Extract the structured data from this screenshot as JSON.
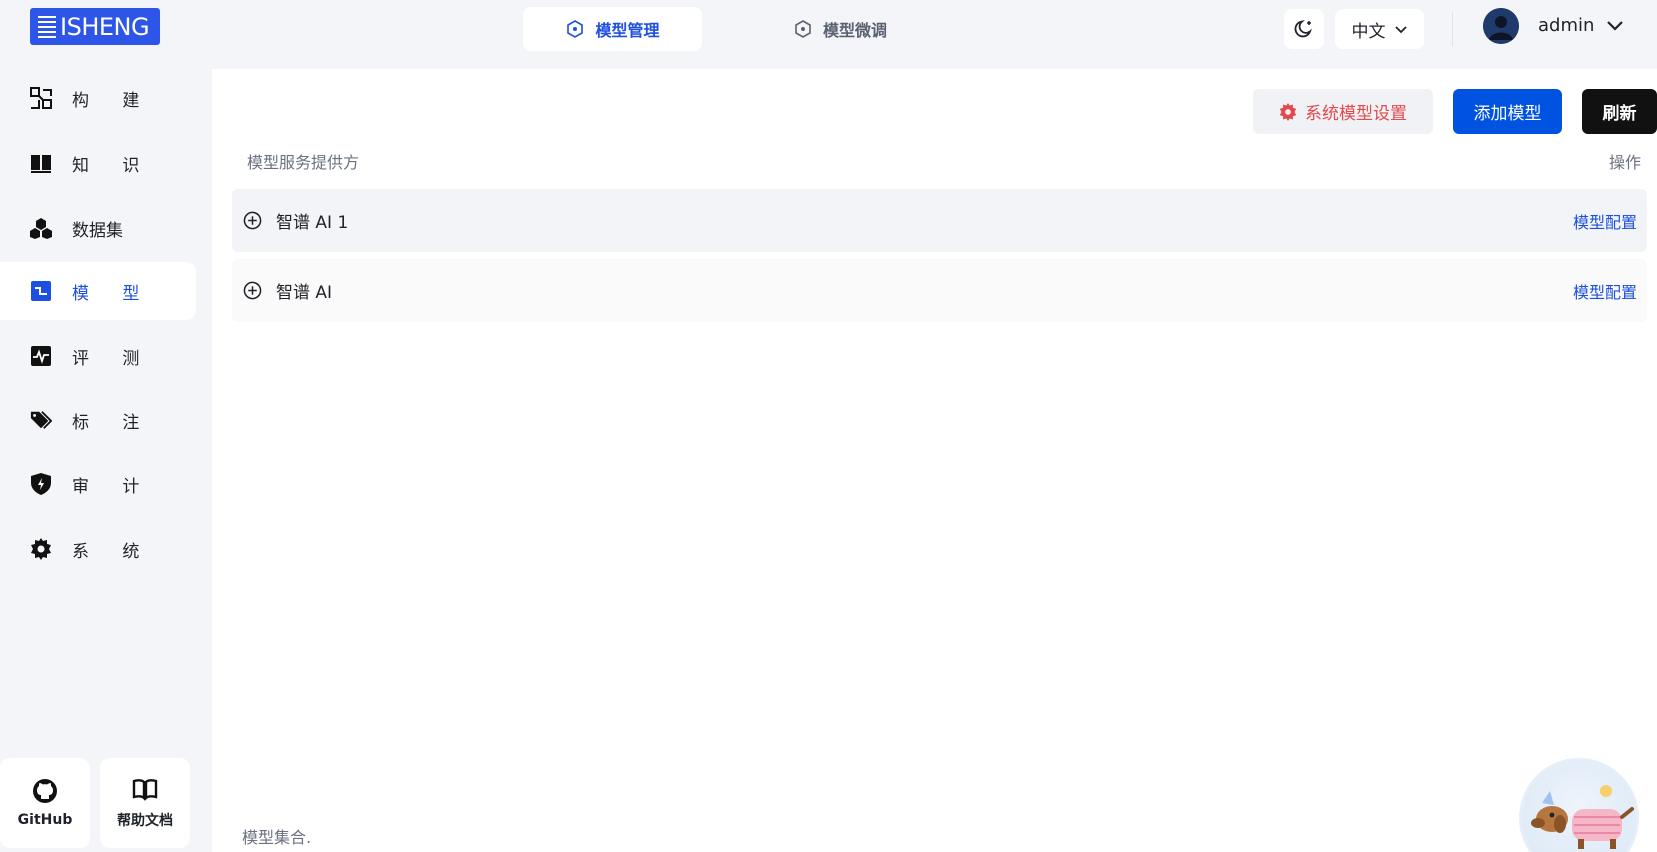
{
  "header": {
    "logo_text": "ISHENG",
    "tabs": [
      {
        "label": "模型管理",
        "active": true
      },
      {
        "label": "模型微调",
        "active": false
      }
    ],
    "language": "中文",
    "username": "admin"
  },
  "sidebar": {
    "items": [
      {
        "label": "构 建",
        "icon": "build-icon"
      },
      {
        "label": "知 识",
        "icon": "book-icon"
      },
      {
        "label": "数据集",
        "icon": "dataset-icon"
      },
      {
        "label": "模 型",
        "icon": "model-icon",
        "active": true
      },
      {
        "label": "评 测",
        "icon": "pulse-icon"
      },
      {
        "label": "标 注",
        "icon": "tag-icon"
      },
      {
        "label": "审 计",
        "icon": "shield-icon"
      },
      {
        "label": "系 统",
        "icon": "gear-icon"
      }
    ],
    "bottom": [
      {
        "label": "GitHub",
        "icon": "github-icon"
      },
      {
        "label": "帮助文档",
        "icon": "open-book-icon"
      }
    ]
  },
  "main": {
    "buttons": {
      "settings": "系统模型设置",
      "add": "添加模型",
      "refresh": "刷新"
    },
    "columns": {
      "provider": "模型服务提供方",
      "action": "操作"
    },
    "rows": [
      {
        "name": "智谱 AI 1",
        "action": "模型配置"
      },
      {
        "name": "智谱 AI",
        "action": "模型配置"
      }
    ],
    "footer_note": "模型集合."
  },
  "colors": {
    "primary": "#0052e0",
    "accent_blue": "#1d4fe0",
    "danger": "#e5484d",
    "logo_bg": "#2d55e8"
  }
}
